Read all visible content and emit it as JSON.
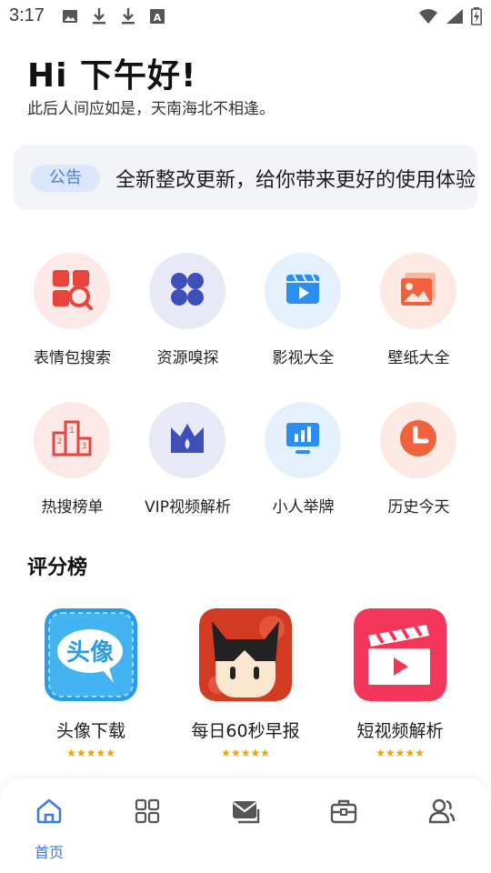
{
  "status_bar": {
    "time": "3:17",
    "left_icons": [
      "image-icon",
      "download-icon",
      "download-icon",
      "font-icon"
    ],
    "right_icons": [
      "wifi-icon",
      "signal-icon",
      "battery-charging-icon"
    ]
  },
  "greeting": {
    "title": "Hi 下午好!",
    "subtitle": "此后人间应如是，天南海北不相逢。"
  },
  "notice": {
    "tag": "公告",
    "text": "全新整改更新，给你带来更好的使用体验"
  },
  "tools": [
    {
      "label": "表情包搜索",
      "icon": "meme-search-icon",
      "bg": "#fde8e8",
      "color": "#e9443b"
    },
    {
      "label": "资源嗅探",
      "icon": "clover-icon",
      "bg": "#e8e9f6",
      "color": "#3f4fb8"
    },
    {
      "label": "影视大全",
      "icon": "video-icon",
      "bg": "#e4f0fc",
      "color": "#2c8ef0"
    },
    {
      "label": "壁纸大全",
      "icon": "wallpaper-icon",
      "bg": "#fde9e4",
      "color": "#f0623c"
    },
    {
      "label": "热搜榜单",
      "icon": "podium-icon",
      "bg": "#fde8e8",
      "color": "#e9443b"
    },
    {
      "label": "VIP视频解析",
      "icon": "crown-icon",
      "bg": "#e8e9f6",
      "color": "#3f4fb8"
    },
    {
      "label": "小人举牌",
      "icon": "sign-board-icon",
      "bg": "#e4f0fc",
      "color": "#2c8ef0"
    },
    {
      "label": "历史今天",
      "icon": "clock-icon",
      "bg": "#fde9e4",
      "color": "#f0623c"
    }
  ],
  "rank": {
    "title": "评分榜",
    "items": [
      {
        "name": "头像下载",
        "stars": "★★★★★",
        "icon": "avatar-app-icon",
        "icon_text": "头像",
        "rating": 5
      },
      {
        "name": "每日60秒早报",
        "stars": "★★★★★",
        "icon": "news-app-icon",
        "rating": 5
      },
      {
        "name": "短视频解析",
        "stars": "★★★★★",
        "icon": "clapperboard-app-icon",
        "rating": 5
      }
    ]
  },
  "bottom_nav": {
    "items": [
      {
        "label": "首页",
        "icon": "home-icon",
        "active": true
      },
      {
        "label": "",
        "icon": "grid-icon",
        "active": false
      },
      {
        "label": "",
        "icon": "mail-icon",
        "active": false
      },
      {
        "label": "",
        "icon": "toolbox-icon",
        "active": false
      },
      {
        "label": "",
        "icon": "users-icon",
        "active": false
      }
    ],
    "active_color": "#3f7be6",
    "inactive_color": "#555555"
  }
}
